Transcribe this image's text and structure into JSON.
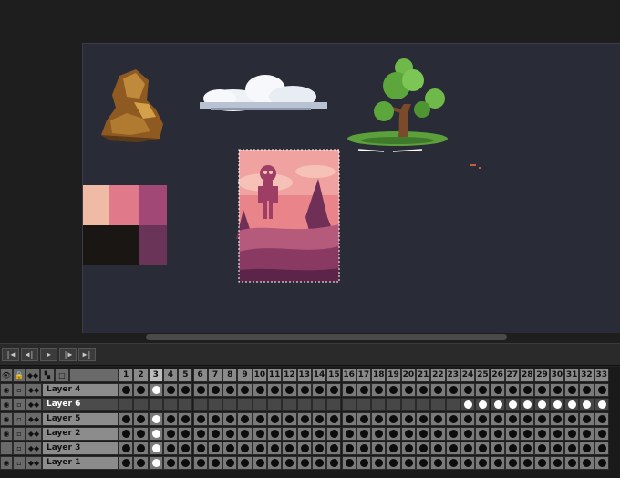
{
  "timeline": {
    "controls": [
      {
        "name": "first-frame-button",
        "glyph": "|◀"
      },
      {
        "name": "prev-frame-button",
        "glyph": "◀|"
      },
      {
        "name": "play-button",
        "glyph": "▶"
      },
      {
        "name": "next-frame-button",
        "glyph": "|▶"
      },
      {
        "name": "last-frame-button",
        "glyph": "▶|"
      }
    ],
    "header_icons": [
      {
        "name": "visibility-header-icon",
        "glyph": "👁"
      },
      {
        "name": "lock-header-icon",
        "glyph": "🔒"
      },
      {
        "name": "onion-skin-header-icon",
        "glyph": "◆◆"
      },
      {
        "name": "link-header-icon",
        "glyph": "▚"
      },
      {
        "name": "cel-header-icon",
        "glyph": "□"
      }
    ],
    "frames": [
      "1",
      "2",
      "3",
      "4",
      "5",
      "6",
      "7",
      "8",
      "9",
      "10",
      "11",
      "12",
      "13",
      "14",
      "15",
      "16",
      "17",
      "18",
      "19",
      "20",
      "21",
      "22",
      "23",
      "24",
      "25",
      "26",
      "27",
      "28",
      "29",
      "30",
      "31",
      "32",
      "33"
    ],
    "current_frame": 3,
    "layers": [
      {
        "name": "Layer 4",
        "visible": true,
        "locked": false,
        "active": false,
        "cels": "full"
      },
      {
        "name": "Layer 6",
        "visible": true,
        "locked": false,
        "active": true,
        "cels": "from24"
      },
      {
        "name": "Layer 5",
        "visible": true,
        "locked": false,
        "active": false,
        "cels": "full"
      },
      {
        "name": "Layer 2",
        "visible": true,
        "locked": false,
        "active": false,
        "cels": "full"
      },
      {
        "name": "Layer 3",
        "visible": false,
        "locked": false,
        "active": false,
        "cels": "full"
      },
      {
        "name": "Layer 1",
        "visible": true,
        "locked": false,
        "active": false,
        "cels": "full"
      }
    ]
  },
  "palette": [
    "#f0bba4",
    "#e07a8a",
    "#a24877",
    "#1a1614",
    "#6a3358"
  ],
  "colors": {
    "canvas_bg": "#292c36",
    "panel_bg": "#232323",
    "accent_pink": "#e8848a"
  }
}
